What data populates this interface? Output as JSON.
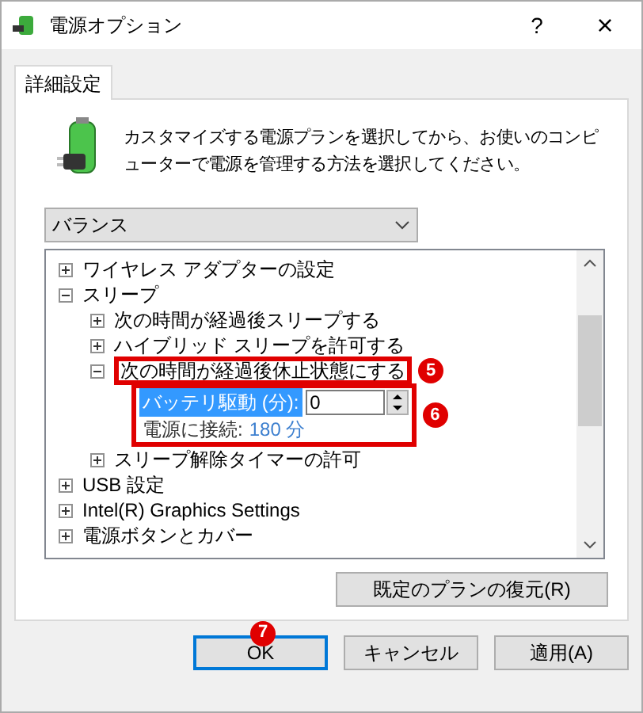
{
  "window": {
    "title": "電源オプション",
    "help": "?",
    "close": "×"
  },
  "tabs": [
    {
      "label": "詳細設定",
      "selected": true
    }
  ],
  "description": "カスタマイズする電源プランを選択してから、お使いのコンピューターで電源を管理する方法を選択してください。",
  "plan_select": {
    "value": "バランス"
  },
  "tree": [
    {
      "label": "ワイヤレス アダプターの設定",
      "expanded": false
    },
    {
      "label": "スリープ",
      "expanded": true,
      "children": [
        {
          "label": "次の時間が経過後スリープする",
          "expanded": false
        },
        {
          "label": "ハイブリッド スリープを許可する",
          "expanded": false
        },
        {
          "label": "次の時間が経過後休止状態にする",
          "expanded": true,
          "callout": "5",
          "settings_callout": "6",
          "settings": [
            {
              "kind": "spin",
              "label": "バッテリ駆動 (分):",
              "value": "0",
              "selected": true
            },
            {
              "kind": "text",
              "label": "電源に接続:",
              "value": "180 分",
              "selected": false
            }
          ]
        },
        {
          "label": "スリープ解除タイマーの許可",
          "expanded": false
        }
      ]
    },
    {
      "label": "USB 設定",
      "expanded": false
    },
    {
      "label": "Intel(R) Graphics Settings",
      "expanded": false
    },
    {
      "label": "電源ボタンとカバー",
      "expanded": false
    }
  ],
  "restore_button": "既定のプランの復元(R)",
  "buttons": [
    {
      "label": "OK",
      "default": true,
      "callout": "7"
    },
    {
      "label": "キャンセル",
      "default": false
    },
    {
      "label": "適用(A)",
      "default": false
    }
  ]
}
